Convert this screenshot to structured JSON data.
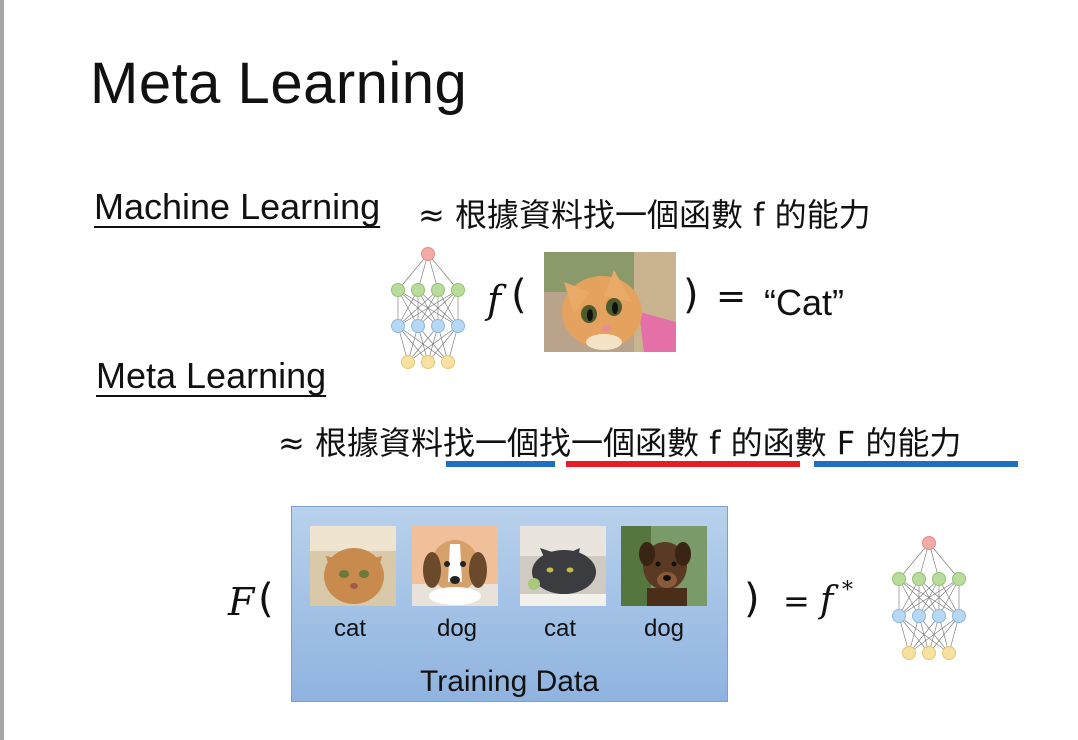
{
  "title": "Meta Learning",
  "ml": {
    "heading": "Machine Learning",
    "definition": "≈ 根據資料找一個函數 f 的能力",
    "equation": {
      "f": "f",
      "open_paren": "(",
      "close_paren": ")",
      "equals": "=",
      "output": "“Cat”"
    }
  },
  "meta": {
    "heading": "Meta Learning",
    "approx": "≈",
    "def_parts": [
      "根據資料找一個",
      "找一個函數 f 的",
      "函數 F 的能力"
    ],
    "underline_colors": [
      "#1f6fc0",
      "#e81c24",
      "#1f6fc0"
    ]
  },
  "bottom_equation": {
    "F": "F",
    "open_paren": "(",
    "close_paren": ")",
    "equals": "=",
    "f": "f",
    "star": "*",
    "training_labels": [
      "cat",
      "dog",
      "cat",
      "dog"
    ],
    "training_caption": "Training Data"
  },
  "colors": {
    "nn_output": "#f4aaa6",
    "nn_hidden1": "#b9dc9c",
    "nn_hidden2": "#b6d8f2",
    "nn_input": "#f7e0a0",
    "training_box": "#a9c6e8"
  }
}
